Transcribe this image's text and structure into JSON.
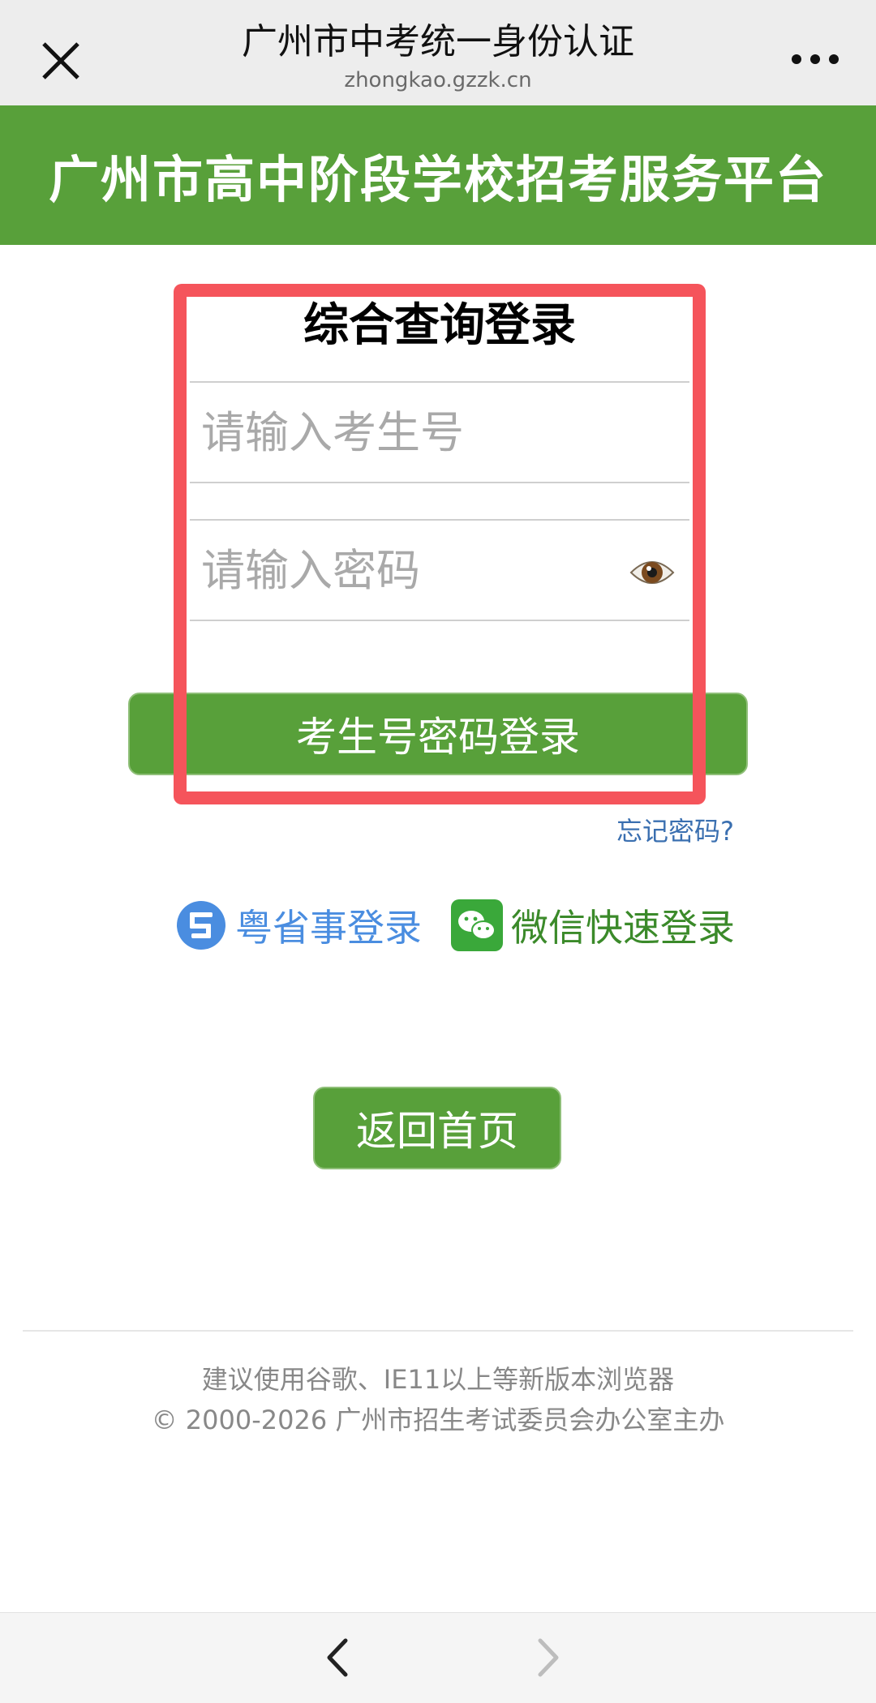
{
  "topbar": {
    "title": "广州市中考统一身份认证",
    "url": "zhongkao.gzzk.cn",
    "close_icon": "close-icon",
    "more_icon": "more-icon"
  },
  "banner": {
    "title": "广州市高中阶段学校招考服务平台",
    "color": "#58a03a"
  },
  "login": {
    "title": "综合查询登录",
    "username_placeholder": "请输入考生号",
    "password_placeholder": "请输入密码",
    "eye_icon": "eye-icon",
    "submit_label": "考生号密码登录",
    "forgot_label": "忘记密码?"
  },
  "alt_login": {
    "yue_label": "粤省事登录",
    "wechat_label": "微信快速登录"
  },
  "home_button": "返回首页",
  "footer": {
    "line1": "建议使用谷歌、IE11以上等新版本浏览器",
    "line2": "© 2000-2026 广州市招生考试委员会办公室主办"
  },
  "highlight_color": "#f5545b"
}
